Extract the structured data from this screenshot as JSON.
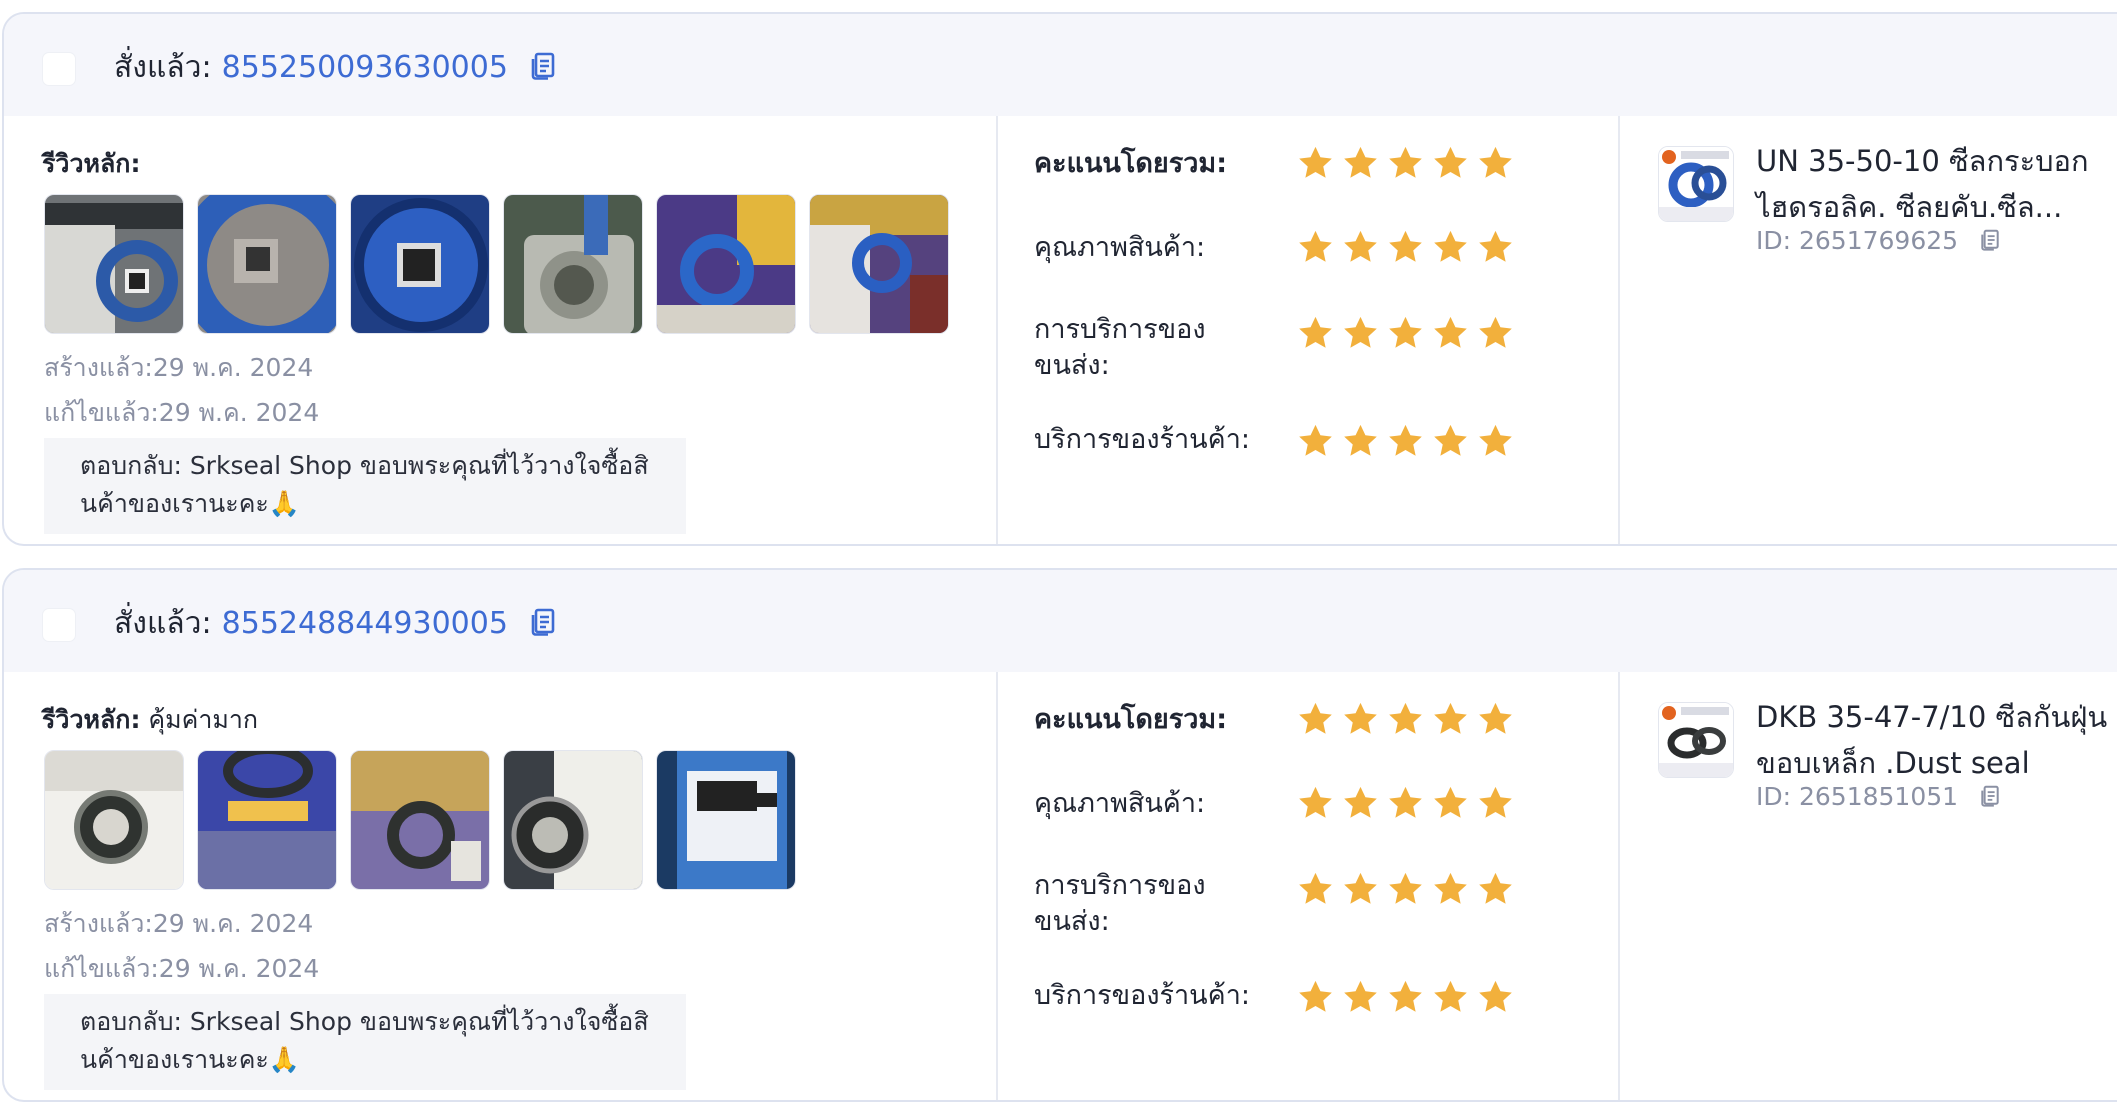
{
  "reviews": [
    {
      "order_label": "สั่งแล้ว:",
      "order_number": "855250093630005",
      "review_label": "รีวิวหลัก:",
      "review_text": "",
      "photos": [
        "seal-caliper-photo",
        "blue-seal-label-photo",
        "blue-seal-qr-photo",
        "metal-part-photo",
        "seal-on-catalog-photo",
        "seal-packaging-photo"
      ],
      "created": "สร้างแล้ว:29 พ.ค. 2024",
      "edited": "แก้ไขแล้ว:29 พ.ค. 2024",
      "reply_line1": "ตอบกลับ: Srkseal Shop ขอบพระคุณที่ไว้วางใจซื้อสิ",
      "reply_line2": "นค้าของเรานะคะ🙏",
      "ratings": [
        {
          "label": "คะแนนโดยรวม:",
          "stars": 5
        },
        {
          "label": "คุณภาพสินค้า:",
          "stars": 5
        },
        {
          "label_line1": "การบริการของ",
          "label_line2": "ขนส่ง:",
          "stars": 5
        },
        {
          "label": "บริการของร้านค้า:",
          "stars": 5
        }
      ],
      "product_name": "UN 35-50-10 ซีลกระบอกไฮดรอลิค. ซีลยคับ.ซีล...",
      "product_id": "ID: 2651769625"
    },
    {
      "order_label": "สั่งแล้ว:",
      "order_number": "855248844930005",
      "review_label": "รีวิวหลัก:",
      "review_text": "คุ้มค่ามาก",
      "photos": [
        "black-seal-label-photo",
        "seal-packaging-photo",
        "seal-on-catalog-photo",
        "seal-label-photo",
        "barcode-label-photo"
      ],
      "created": "สร้างแล้ว:29 พ.ค. 2024",
      "edited": "แก้ไขแล้ว:29 พ.ค. 2024",
      "reply_line1": "ตอบกลับ: Srkseal Shop ขอบพระคุณที่ไว้วางใจซื้อสิ",
      "reply_line2": "นค้าของเรานะคะ🙏",
      "ratings": [
        {
          "label": "คะแนนโดยรวม:",
          "stars": 5
        },
        {
          "label": "คุณภาพสินค้า:",
          "stars": 5
        },
        {
          "label_line1": "การบริการของ",
          "label_line2": "ขนส่ง:",
          "stars": 5
        },
        {
          "label": "บริการของร้านค้า:",
          "stars": 5
        }
      ],
      "product_name": "DKB 35-47-7/10 ซีลกันฝุ่นขอบเหล็ก .Dust seal",
      "product_id": "ID: 2651851051"
    }
  ],
  "colors": {
    "star": "#f2b03c",
    "link": "#3d6bd3",
    "header_bg": "#f5f6fb",
    "muted": "#8a90a3"
  }
}
